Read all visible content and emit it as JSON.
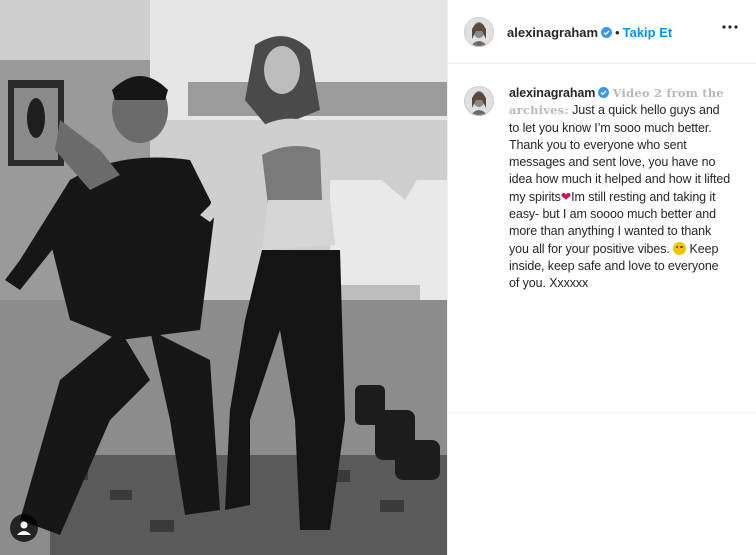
{
  "post": {
    "username": "alexinagraham",
    "verified": true,
    "follow_label": "Takip Et",
    "separator": "•",
    "caption": {
      "username": "alexinagraham",
      "highlight": "Video 2 from the archives:",
      "text_1": " Just a quick hello guys and to let you know I’m sooo much better. Thank you to everyone who sent messages and sent love, you have no idea how much it helped and how it lifted my spirits",
      "heart": "❤",
      "text_2": "Im still resting and taking it easy- but I am soooo much better and more than anything I wanted to thank you all for your positive vibes. ",
      "text_3": " Keep inside, keep safe and love to everyone of you. Xxxxxx"
    }
  },
  "icons": {
    "more": "more-options-icon",
    "verified": "verified-badge-icon",
    "video": "video-icon",
    "emoji": "face-emoji-icon"
  },
  "colors": {
    "follow": "#0095f6",
    "verified": "#3897f0",
    "text": "#262626"
  }
}
